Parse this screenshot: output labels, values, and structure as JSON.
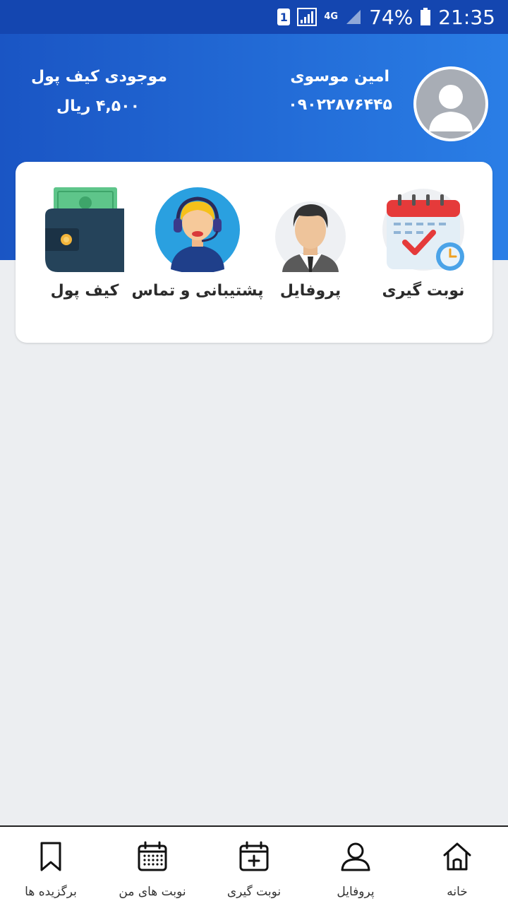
{
  "status_bar": {
    "sim_slot": "1",
    "network_type": "4G",
    "battery": "74%",
    "time": "21:35"
  },
  "header": {
    "user_name": "امین موسوی",
    "user_phone": "۰۹۰۲۲۸۷۶۴۴۵",
    "wallet_title": "موجودی کیف پول",
    "wallet_balance": "۴,۵۰۰ ریال"
  },
  "services": [
    {
      "label": "نوبت گیری",
      "icon": "calendar-check-icon"
    },
    {
      "label": "پروفایل",
      "icon": "businessman-icon"
    },
    {
      "label": "پشتیبانی و تماس",
      "icon": "support-agent-icon"
    },
    {
      "label": "کیف پول",
      "icon": "wallet-icon"
    }
  ],
  "bottom_nav": [
    {
      "label": "خانه",
      "icon": "home-icon"
    },
    {
      "label": "پروفایل",
      "icon": "user-icon"
    },
    {
      "label": "نوبت گیری",
      "icon": "calendar-plus-icon"
    },
    {
      "label": "نوبت های من",
      "icon": "calendar-grid-icon"
    },
    {
      "label": "برگزیده ها",
      "icon": "bookmark-icon"
    }
  ],
  "colors": {
    "header_start": "#1a55c4",
    "header_end": "#2a7ee6",
    "status_bar": "#1446b0",
    "background": "#eceef1"
  }
}
